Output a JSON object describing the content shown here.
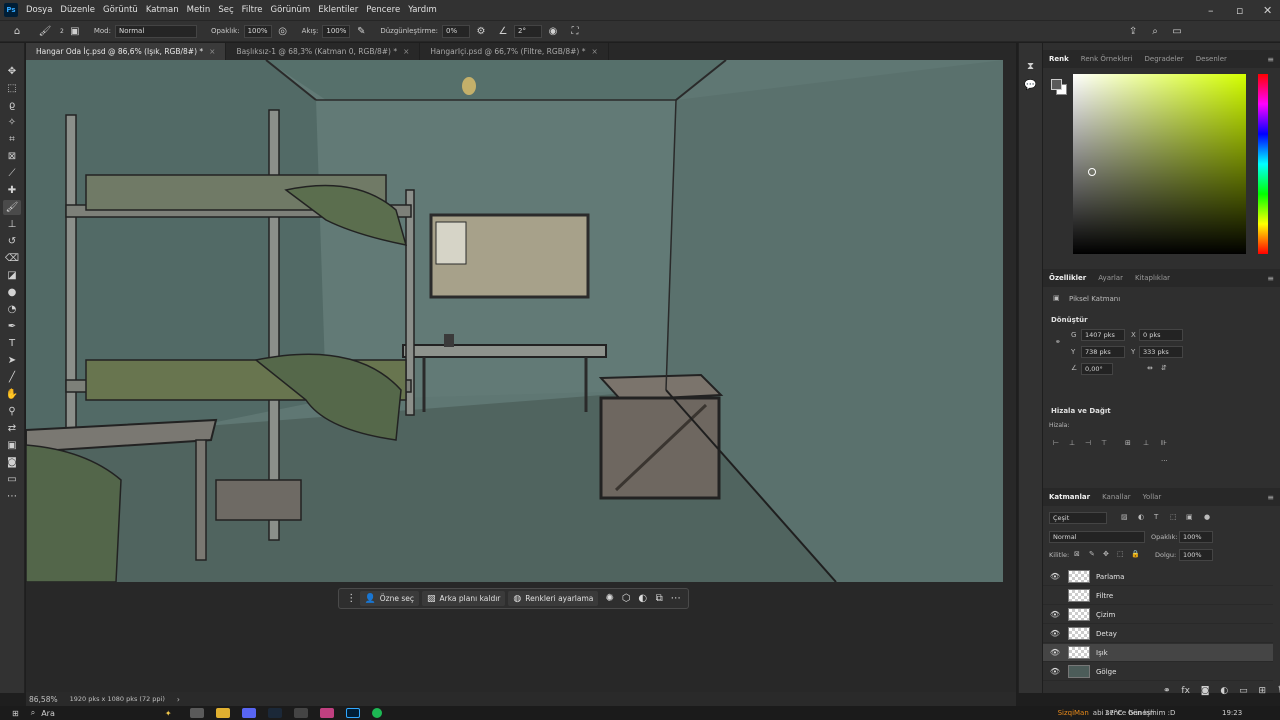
{
  "menubar": {
    "logo": "Ps",
    "items": [
      "Dosya",
      "Düzenle",
      "Görüntü",
      "Katman",
      "Metin",
      "Seç",
      "Filtre",
      "Görünüm",
      "Eklentiler",
      "Pencere",
      "Yardım"
    ]
  },
  "options": {
    "brush_size": "2",
    "mode_label": "Mod:",
    "mode_value": "Normal",
    "opacity_label": "Opaklık:",
    "opacity_value": "100%",
    "flow_label": "Akış:",
    "flow_value": "100%",
    "smoothing_label": "Düzgünleştirme:",
    "smoothing_value": "0%",
    "angle_value": "2°"
  },
  "tabs": [
    {
      "label": "Hangar Oda İç.psd @ 86,6% (Işık, RGB/8#) *",
      "active": true
    },
    {
      "label": "Başlıksız-1 @ 68,3% (Katman 0, RGB/8#) *",
      "active": false
    },
    {
      "label": "HangarIçi.psd @ 66,7% (Filtre, RGB/8#) *",
      "active": false
    }
  ],
  "context_bar": {
    "select_subject": "Özne seç",
    "remove_bg": "Arka planı kaldır",
    "adjust_colors": "Renkleri ayarlama"
  },
  "status": {
    "zoom": "86,58%",
    "doc_info": "1920 pks x 1080 pks (72 ppi)"
  },
  "color_panel": {
    "tabs": [
      "Renk",
      "Renk Örnekleri",
      "Degradeler",
      "Desenler"
    ],
    "fg_color": "#5a5a5a",
    "bg_color": "#ffffff",
    "hue_color": "#d4ff00"
  },
  "properties": {
    "tabs": [
      "Özellikler",
      "Ayarlar",
      "Kitaplıklar"
    ],
    "layer_type": "Piksel Katmanı",
    "transform_title": "Dönüştür",
    "w_label": "G",
    "w_value": "1407 pks",
    "h_label": "Y",
    "h_value": "738 pks",
    "x_label": "X",
    "x_value": "0 pks",
    "y_label": "Y",
    "y_value": "333 pks",
    "angle": "0,00°",
    "align_title": "Hizala ve Dağıt",
    "align_label": "Hizala:",
    "more": "..."
  },
  "layers": {
    "tabs": [
      "Katmanlar",
      "Kanallar",
      "Yollar"
    ],
    "filter_kind": "Çeşit",
    "blend_mode": "Normal",
    "opacity_label": "Opaklık:",
    "opacity_value": "100%",
    "lock_label": "Kilitle:",
    "fill_label": "Dolgu:",
    "fill_value": "100%",
    "items": [
      {
        "name": "Parlama",
        "visible": true,
        "selected": false
      },
      {
        "name": "Filtre",
        "visible": false,
        "selected": false
      },
      {
        "name": "Çizim",
        "visible": true,
        "selected": false
      },
      {
        "name": "Detay",
        "visible": true,
        "selected": false
      },
      {
        "name": "Işık",
        "visible": true,
        "selected": true
      },
      {
        "name": "Gölge",
        "visible": true,
        "selected": false
      }
    ]
  },
  "taskbar": {
    "search": "Ara",
    "notification": "abi sence ben kimim :D",
    "notification_user": "SizqiMan",
    "weather": "27°C",
    "weather_desc": "Güneşli",
    "time": "19:23"
  }
}
